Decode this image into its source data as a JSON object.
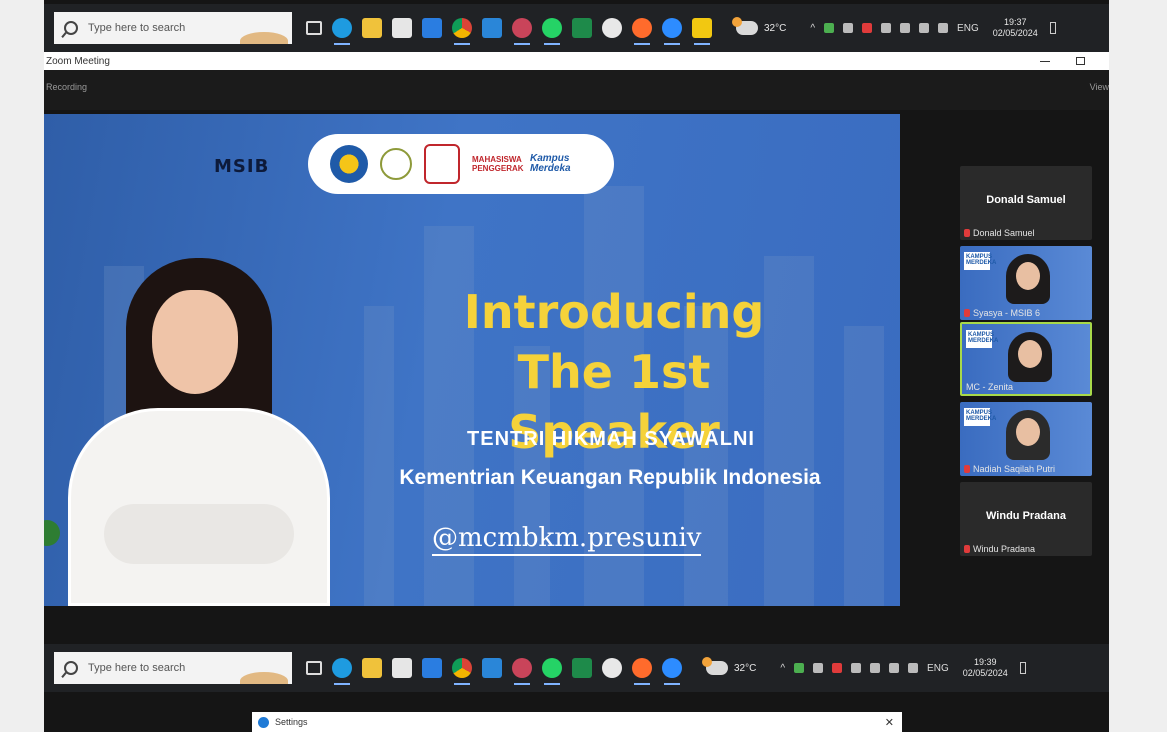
{
  "taskbar_top": {
    "search_placeholder": "Type here to search",
    "temperature": "32°C",
    "language": "ENG",
    "time": "19:37",
    "date": "02/05/2024"
  },
  "window": {
    "title": "Zoom Meeting",
    "recording_label": "Recording",
    "view_label": "View"
  },
  "slide": {
    "brand": "MSIB",
    "partner_badge_1": "MAHASISWA PENGGERAK",
    "partner_badge_2": "Kampus Merdeka",
    "headline_line1": "Introducing",
    "headline_line2": "The 1st Speaker",
    "speaker_name": "TENTRI HIKMAH SYAWALNI",
    "speaker_org": "Kementrian Keuangan Republik Indonesia",
    "handle": "@mcmbkm.presuniv"
  },
  "participants": [
    {
      "name": "Donald Samuel",
      "label": "Donald Samuel",
      "video": false
    },
    {
      "name": "Syasya - MSIB 6",
      "label": "Syasya - MSIB 6",
      "video": true,
      "badge": "KAMPUS MERDEKA"
    },
    {
      "name": "MC - Zenita",
      "label": "MC - Zenita",
      "video": true,
      "badge": "KAMPUS MERDEKA",
      "selected": true
    },
    {
      "name": "Nadiah Saqilah Putri",
      "label": "Nadiah Saqilah Putri",
      "video": true,
      "badge": "KAMPUS MERDEKA"
    },
    {
      "name": "Windu Pradana",
      "label": "Windu Pradana",
      "video": false
    }
  ],
  "taskbar_bottom": {
    "search_placeholder": "Type here to search",
    "temperature": "32°C",
    "language": "ENG",
    "time": "19:39",
    "date": "02/05/2024"
  },
  "settings_window": {
    "title": "Settings",
    "close": "✕"
  },
  "icons": [
    "search-icon",
    "task-view-icon",
    "edge-icon",
    "file-explorer-icon",
    "store-icon",
    "mail-icon",
    "chrome-icon",
    "vscode-icon",
    "app-icon",
    "whatsapp-icon",
    "excel-icon",
    "obs-icon",
    "firefox-icon",
    "zoom-icon",
    "powerbi-icon",
    "weather-icon",
    "wifi-icon",
    "volume-icon"
  ]
}
